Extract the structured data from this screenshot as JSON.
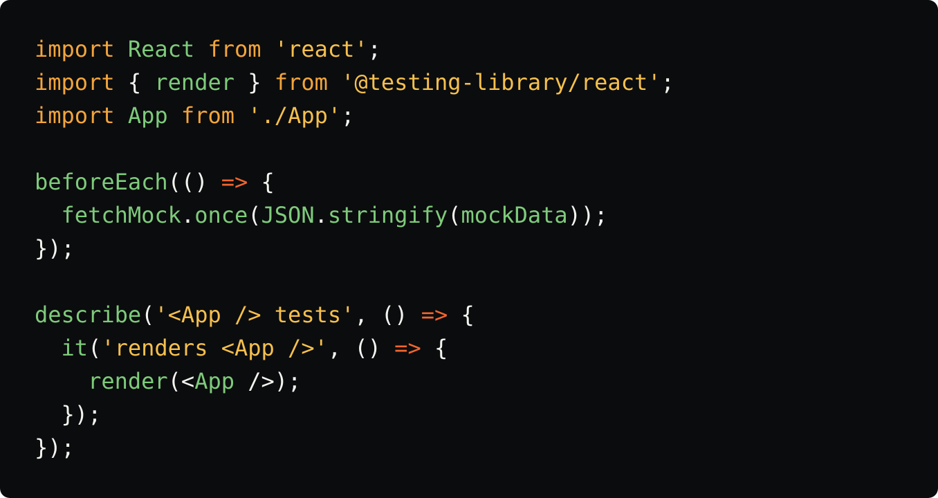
{
  "colors": {
    "background": "#0b0c0e",
    "keyword": "#f3a53b",
    "identifier": "#7ecb7b",
    "string": "#f6c04d",
    "arrow": "#f2662d",
    "punctuation": "#f4f4f0"
  },
  "code": {
    "lines": [
      [
        {
          "t": "import",
          "k": "keyword"
        },
        {
          "t": " ",
          "k": "text"
        },
        {
          "t": "React",
          "k": "ident"
        },
        {
          "t": " ",
          "k": "text"
        },
        {
          "t": "from",
          "k": "keyword"
        },
        {
          "t": " ",
          "k": "text"
        },
        {
          "t": "'react'",
          "k": "string"
        },
        {
          "t": ";",
          "k": "punct"
        }
      ],
      [
        {
          "t": "import",
          "k": "keyword"
        },
        {
          "t": " { ",
          "k": "punct"
        },
        {
          "t": "render",
          "k": "ident"
        },
        {
          "t": " } ",
          "k": "punct"
        },
        {
          "t": "from",
          "k": "keyword"
        },
        {
          "t": " ",
          "k": "text"
        },
        {
          "t": "'@testing-library/react'",
          "k": "string"
        },
        {
          "t": ";",
          "k": "punct"
        }
      ],
      [
        {
          "t": "import",
          "k": "keyword"
        },
        {
          "t": " ",
          "k": "text"
        },
        {
          "t": "App",
          "k": "ident"
        },
        {
          "t": " ",
          "k": "text"
        },
        {
          "t": "from",
          "k": "keyword"
        },
        {
          "t": " ",
          "k": "text"
        },
        {
          "t": "'./App'",
          "k": "string"
        },
        {
          "t": ";",
          "k": "punct"
        }
      ],
      [],
      [
        {
          "t": "beforeEach",
          "k": "ident"
        },
        {
          "t": "(() ",
          "k": "punct"
        },
        {
          "t": "=>",
          "k": "arrow"
        },
        {
          "t": " {",
          "k": "punct"
        }
      ],
      [
        {
          "t": "  ",
          "k": "text"
        },
        {
          "t": "fetchMock",
          "k": "ident"
        },
        {
          "t": ".",
          "k": "punct"
        },
        {
          "t": "once",
          "k": "ident"
        },
        {
          "t": "(",
          "k": "punct"
        },
        {
          "t": "JSON",
          "k": "ident"
        },
        {
          "t": ".",
          "k": "punct"
        },
        {
          "t": "stringify",
          "k": "ident"
        },
        {
          "t": "(",
          "k": "punct"
        },
        {
          "t": "mockData",
          "k": "ident"
        },
        {
          "t": "));",
          "k": "punct"
        }
      ],
      [
        {
          "t": "});",
          "k": "punct"
        }
      ],
      [],
      [
        {
          "t": "describe",
          "k": "ident"
        },
        {
          "t": "(",
          "k": "punct"
        },
        {
          "t": "'<App /> tests'",
          "k": "string"
        },
        {
          "t": ", () ",
          "k": "punct"
        },
        {
          "t": "=>",
          "k": "arrow"
        },
        {
          "t": " {",
          "k": "punct"
        }
      ],
      [
        {
          "t": "  ",
          "k": "text"
        },
        {
          "t": "it",
          "k": "ident"
        },
        {
          "t": "(",
          "k": "punct"
        },
        {
          "t": "'renders <App />'",
          "k": "string"
        },
        {
          "t": ", () ",
          "k": "punct"
        },
        {
          "t": "=>",
          "k": "arrow"
        },
        {
          "t": " {",
          "k": "punct"
        }
      ],
      [
        {
          "t": "    ",
          "k": "text"
        },
        {
          "t": "render",
          "k": "ident"
        },
        {
          "t": "(<",
          "k": "punct"
        },
        {
          "t": "App",
          "k": "ident"
        },
        {
          "t": " />);",
          "k": "punct"
        }
      ],
      [
        {
          "t": "  });",
          "k": "punct"
        }
      ],
      [
        {
          "t": "});",
          "k": "punct"
        }
      ]
    ]
  }
}
